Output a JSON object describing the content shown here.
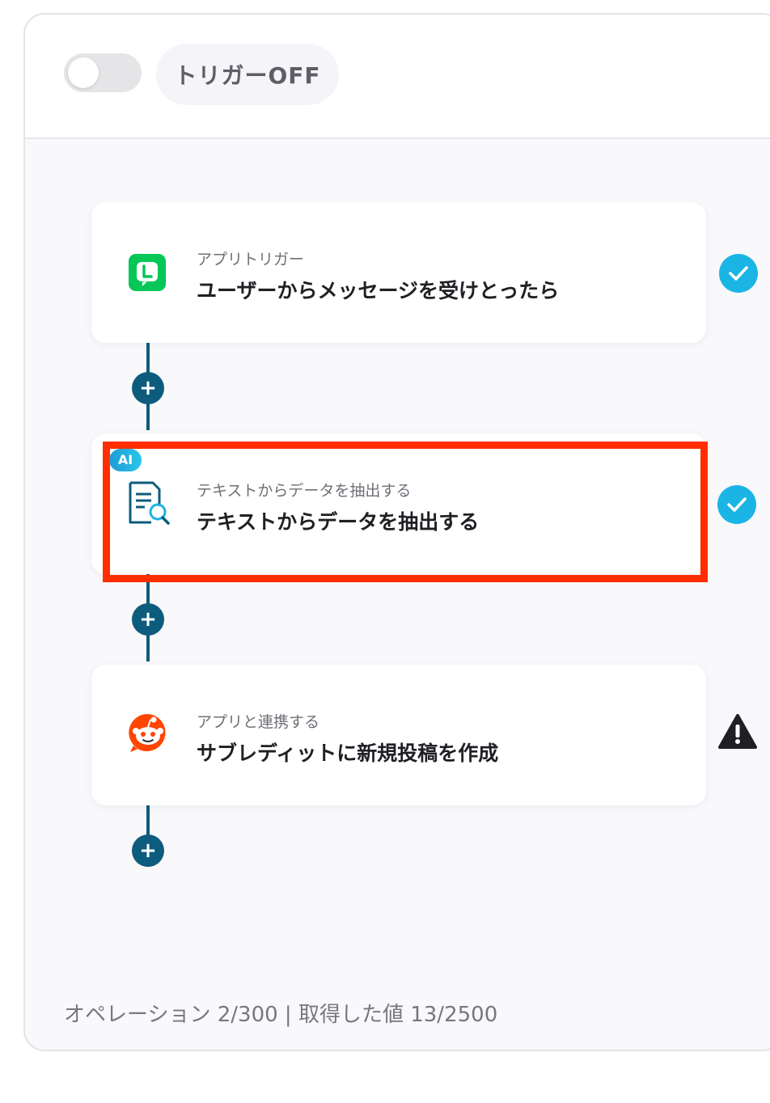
{
  "header": {
    "toggle_state": "off",
    "trigger_label": "トリガーOFF"
  },
  "steps": [
    {
      "subtitle": "アプリトリガー",
      "title": "ユーザーからメッセージを受けとったら",
      "icon": "line-app-icon",
      "status": "check"
    },
    {
      "badge": "AI",
      "subtitle": "テキストからデータを抽出する",
      "title": "テキストからデータを抽出する",
      "icon": "document-search-icon",
      "status": "check"
    },
    {
      "subtitle": "アプリと連携する",
      "title": "サブレディットに新規投稿を作成",
      "icon": "reddit-icon",
      "status": "warning"
    }
  ],
  "footer": {
    "text": "オペレーション 2/300 | 取得した値 13/2500"
  },
  "colors": {
    "connector": "#0d5c7d",
    "check": "#1ab5e4",
    "highlight": "#ff2d00",
    "line_green": "#06c755",
    "reddit_orange": "#ff4500"
  }
}
